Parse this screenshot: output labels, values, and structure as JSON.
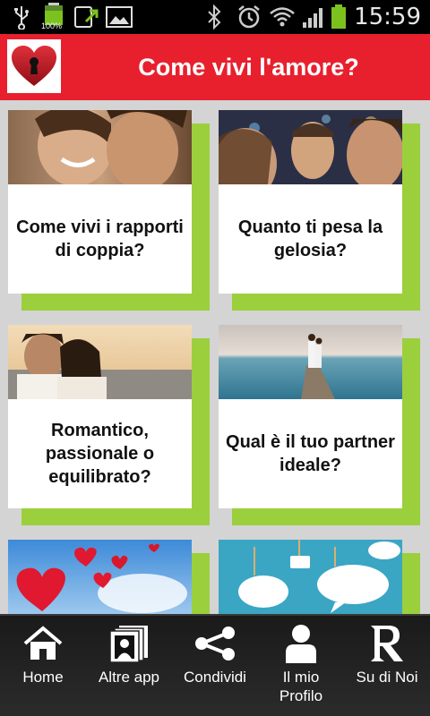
{
  "status_bar": {
    "battery_small_text": "100%",
    "time": "15:59",
    "icons": [
      "usb-icon",
      "battery-small-icon",
      "upload-icon",
      "gallery-icon",
      "bluetooth-icon",
      "alarm-icon",
      "wifi-icon",
      "signal-icon",
      "battery-icon"
    ]
  },
  "header": {
    "title": "Come vivi l'amore?",
    "logo_icon": "heart-lock-icon",
    "color": "#e8202e"
  },
  "cards": [
    {
      "label": "Come vivi i rapporti di coppia?"
    },
    {
      "label": "Quanto ti pesa la gelosia?"
    },
    {
      "label": "Romantico, passionale o equilibrato?"
    },
    {
      "label": "Qual è il tuo partner ideale?"
    },
    {
      "label": ""
    },
    {
      "label": ""
    }
  ],
  "accent_green": "#9ccf3c",
  "bottom_nav": {
    "items": [
      {
        "label": "Home",
        "icon": "home-icon"
      },
      {
        "label": "Altre app",
        "icon": "apps-icon"
      },
      {
        "label": "Condividi",
        "icon": "share-icon"
      },
      {
        "label": "Il mio\nProfilo",
        "icon": "profile-icon"
      },
      {
        "label": "Su di Noi",
        "icon": "about-icon"
      }
    ]
  }
}
